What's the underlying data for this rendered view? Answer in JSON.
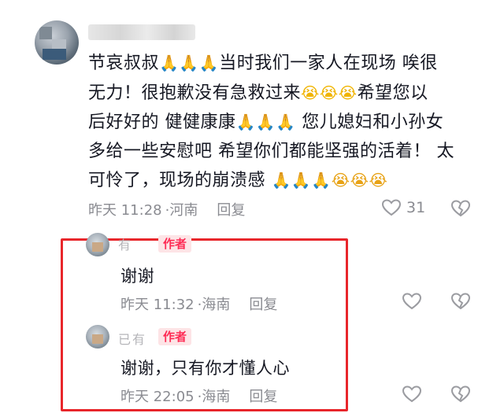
{
  "main_comment": {
    "avatar_icon": "avatar-blurred",
    "text_lines": [
      [
        "节哀叔叔",
        "🙏🙏🙏",
        "当时我们一家人在现场 唉很"
      ],
      [
        "无力！很抱歉没有急救过来",
        "😭😭😭",
        "希望您以"
      ],
      [
        "后好好的 健健康康",
        "🙏🙏🙏",
        " 您儿媳妇和小孙女"
      ],
      [
        "多给一些安慰吧 希望你们都能坚强的活着！ 太"
      ],
      [
        "可怜了，现场的崩溃感 ",
        "🙏🙏🙏😭😭😭"
      ]
    ],
    "date": "昨天 11:28",
    "location": "河南",
    "reply_label": "回复",
    "like_count": "31"
  },
  "replies": [
    {
      "author_badge": "作者",
      "name_fragment": "有",
      "text": "谢谢",
      "date": "昨天 11:32",
      "location": "海南",
      "reply_label": "回复"
    },
    {
      "author_badge": "作者",
      "name_fragment": "已有",
      "text": "谢谢，只有你才懂人心",
      "date": "昨天 22:05",
      "location": "海南",
      "reply_label": "回复"
    }
  ],
  "colors": {
    "highlight_border": "#e8262b",
    "badge_bg": "#fde4e6",
    "badge_text": "#fe2c55",
    "meta_text": "#8a8b91"
  }
}
